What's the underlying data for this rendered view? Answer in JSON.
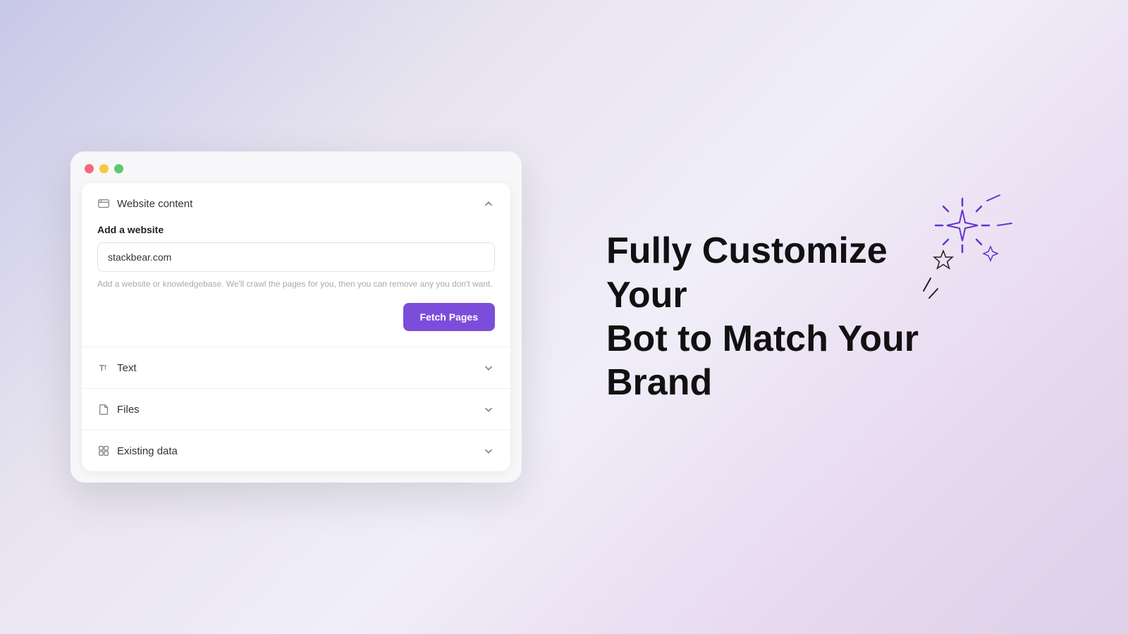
{
  "browser": {
    "dots": [
      "red",
      "yellow",
      "green"
    ]
  },
  "accordion": {
    "website_content": {
      "title": "Website content",
      "expanded": true,
      "field_label": "Add a website",
      "input_value": "stackbear.com",
      "help_text": "Add a website or knowledgebase. We'll crawl the pages for you, then you can remove any you don't want.",
      "fetch_button": "Fetch Pages"
    },
    "text": {
      "title": "Text",
      "expanded": false
    },
    "files": {
      "title": "Files",
      "expanded": false
    },
    "existing_data": {
      "title": "Existing data",
      "expanded": false
    }
  },
  "headline": {
    "line1": "Fully Customize Your",
    "line2": "Bot to Match Your Brand"
  },
  "colors": {
    "accent": "#7c4ddb",
    "dot_red": "#f4697a",
    "dot_yellow": "#f5c842",
    "dot_green": "#5cc96e"
  }
}
